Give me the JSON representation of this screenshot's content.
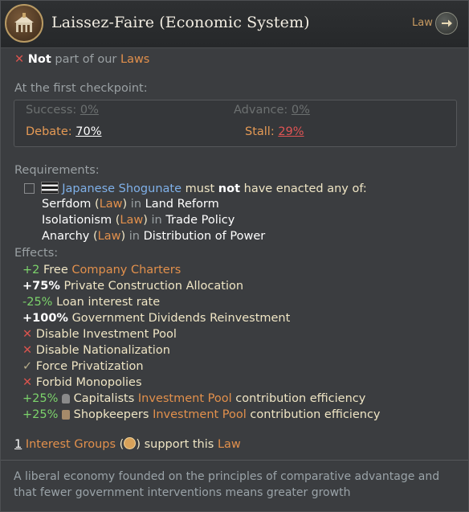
{
  "header": {
    "title": "Laissez-Faire (Economic System)",
    "tag_label": "Law",
    "tag_icon": "arrow-right-icon",
    "law_icon": "market-building-icon"
  },
  "status": {
    "not_label": "Not",
    "rest": "part of our",
    "laws_link": "Laws"
  },
  "checkpoint": {
    "heading": "At the first checkpoint:",
    "success_label": "Success:",
    "success_value": "0%",
    "advance_label": "Advance:",
    "advance_value": "0%",
    "debate_label": "Debate:",
    "debate_value": "70%",
    "stall_label": "Stall:",
    "stall_value": "29%"
  },
  "requirements": {
    "heading": "Requirements:",
    "country": "Japanese Shogunate",
    "must": "must",
    "not": "not",
    "rest": "have enacted any of:",
    "items": [
      {
        "law": "Serfdom",
        "type": "Law",
        "in": "in",
        "group": "Land Reform"
      },
      {
        "law": "Isolationism",
        "type": "Law",
        "in": "in",
        "group": "Trade Policy"
      },
      {
        "law": "Anarchy",
        "type": "Law",
        "in": "in",
        "group": "Distribution of Power"
      }
    ]
  },
  "effects": {
    "heading": "Effects:",
    "company_charters": {
      "value": "+2",
      "text": "Free",
      "link": "Company Charters"
    },
    "private_construction": {
      "value": "+75%",
      "text": "Private Construction Allocation"
    },
    "loan_interest": {
      "value": "-25%",
      "text": "Loan interest rate"
    },
    "gov_dividends": {
      "value": "+100%",
      "text": "Government Dividends Reinvestment"
    },
    "disable_investment_pool": "Disable Investment Pool",
    "disable_nationalization": "Disable Nationalization",
    "force_privatization": "Force Privatization",
    "forbid_monopolies": "Forbid Monopolies",
    "capitalists": {
      "value": "+25%",
      "group": "Capitalists",
      "link": "Investment Pool",
      "text": "contribution efficiency"
    },
    "shopkeepers": {
      "value": "+25%",
      "group": "Shopkeepers",
      "link": "Investment Pool",
      "text": "contribution efficiency"
    }
  },
  "support": {
    "count": "1",
    "link": "Interest Groups",
    "rest": "support this",
    "law_link": "Law"
  },
  "description": "A liberal economy founded on the principles of comparative advantage and that fewer government interventions means greater growth",
  "colors": {
    "positive": "#7cd36b",
    "link": "#e2904c",
    "negative": "#d9544e",
    "text": "#efe5c4"
  }
}
